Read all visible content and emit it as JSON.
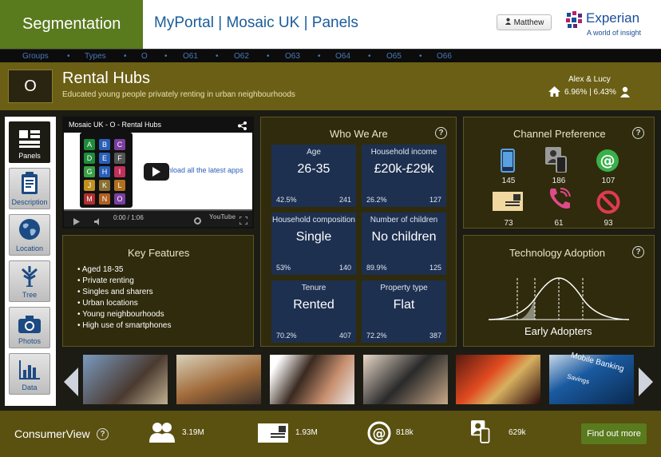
{
  "header": {
    "section": "Segmentation",
    "title": "MyPortal | Mosaic UK | Panels",
    "user_button": "Matthew",
    "brand": "Experian",
    "brand_tagline": "A world of insight"
  },
  "nav": [
    "Groups",
    "Types",
    "O",
    "O61",
    "O62",
    "O63",
    "O64",
    "O65",
    "O66"
  ],
  "segment": {
    "code": "O",
    "name": "Rental Hubs",
    "description": "Educated young people privately renting in urban neighbourhoods",
    "pair_name": "Alex & Lucy",
    "pair_stats": "6.96% | 6.43%"
  },
  "sidebar": [
    {
      "label": "Panels",
      "icon": "panels-icon"
    },
    {
      "label": "Description",
      "icon": "clipboard-icon"
    },
    {
      "label": "Location",
      "icon": "globe-icon"
    },
    {
      "label": "Tree",
      "icon": "tree-icon"
    },
    {
      "label": "Photos",
      "icon": "camera-icon"
    },
    {
      "label": "Data",
      "icon": "bar-chart-icon"
    }
  ],
  "video": {
    "title": "Mosaic UK - O - Rental Hubs",
    "overlay_text": "nload all the latest apps",
    "time": "0:00 / 1:06",
    "app_letters": [
      "A",
      "B",
      "C",
      "D",
      "E",
      "F",
      "G",
      "H",
      "I",
      "J",
      "K",
      "L",
      "M",
      "N",
      "O"
    ],
    "app_colors": [
      "#1e8c3a",
      "#2a5fb8",
      "#7a3fa0",
      "#1e8c3a",
      "#2a5fb8",
      "#555555",
      "#3aa045",
      "#2a5fb8",
      "#c0305a",
      "#c09020",
      "#8a7030",
      "#b07020",
      "#b03030",
      "#b06020",
      "#7a3fa0"
    ]
  },
  "who_we_are": {
    "title": "Who We Are",
    "tiles": [
      {
        "label": "Age",
        "value": "26-35",
        "pct": "42.5%",
        "index": "241"
      },
      {
        "label": "Household income",
        "value": "£20k-£29k",
        "pct": "26.2%",
        "index": "127"
      },
      {
        "label": "Household composition",
        "value": "Single",
        "pct": "53%",
        "index": "140"
      },
      {
        "label": "Number of children",
        "value": "No children",
        "pct": "89.9%",
        "index": "125"
      },
      {
        "label": "Tenure",
        "value": "Rented",
        "pct": "70.2%",
        "index": "407"
      },
      {
        "label": "Property type",
        "value": "Flat",
        "pct": "72.2%",
        "index": "387"
      }
    ]
  },
  "channel": {
    "title": "Channel Preference",
    "items": [
      {
        "icon": "mobile-phone-icon",
        "count": "145"
      },
      {
        "icon": "person-phone-icon",
        "count": "186"
      },
      {
        "icon": "email-at-icon",
        "count": "107"
      },
      {
        "icon": "mail-letter-icon",
        "count": "73"
      },
      {
        "icon": "landline-phone-icon",
        "count": "61"
      },
      {
        "icon": "no-contact-icon",
        "count": "93"
      }
    ]
  },
  "key_features": {
    "title": "Key Features",
    "items": [
      "Aged 18-35",
      "Private renting",
      "Singles and sharers",
      "Urban locations",
      "Young neighbourhoods",
      "High use of smartphones"
    ]
  },
  "technology": {
    "title": "Technology Adoption",
    "label": "Early Adopters"
  },
  "photos": [
    {
      "name": "photo-young-people-city"
    },
    {
      "name": "photo-group-outdoors"
    },
    {
      "name": "photo-couple-drinks"
    },
    {
      "name": "photo-tablet-user"
    },
    {
      "name": "photo-party-night"
    },
    {
      "name": "photo-mobile-banking",
      "text": "Mobile Banking",
      "subtext": "Savings"
    }
  ],
  "footer": {
    "title": "ConsumerView",
    "stats": [
      {
        "icon": "people-icon",
        "value": "3.19M"
      },
      {
        "icon": "mail-letter-icon",
        "value": "1.93M"
      },
      {
        "icon": "email-at-icon",
        "value": "818k"
      },
      {
        "icon": "person-phone-icon",
        "value": "629k"
      }
    ],
    "button": "Find out more"
  },
  "colors": {
    "header_green": "#5a7a1e",
    "header_blue": "#1a5c9a",
    "segment_bar": "#6b5f15",
    "panel_bg": "#2f2b0c",
    "tile_bg": "#1e3050",
    "footer_bg": "#5a5010"
  }
}
